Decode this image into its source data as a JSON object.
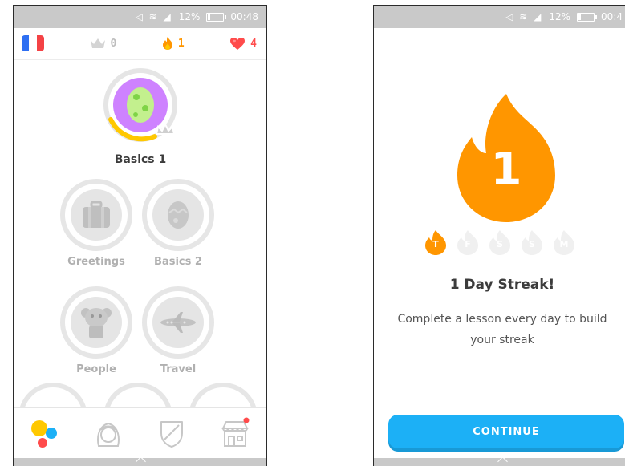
{
  "status_bar": {
    "battery": "12%",
    "time_left": "00:48",
    "time_right": "00:4"
  },
  "topbar": {
    "crowns": "0",
    "streak": "1",
    "hearts": "4"
  },
  "skills": {
    "main": {
      "label": "Basics 1"
    },
    "greetings": {
      "label": "Greetings"
    },
    "basics2": {
      "label": "Basics 2"
    },
    "people": {
      "label": "People"
    },
    "travel": {
      "label": "Travel"
    }
  },
  "tabs": [
    "learn",
    "profile",
    "leagues",
    "shop"
  ],
  "streak_screen": {
    "number": "1",
    "days": [
      "T",
      "F",
      "S",
      "S",
      "M"
    ],
    "title": "1 Day Streak!",
    "description": "Complete a lesson every day to build your streak",
    "continue_label": "CONTINUE"
  },
  "colors": {
    "accent_orange": "#ff9600",
    "accent_blue": "#1cb0f6",
    "heart_red": "#ff4b4b",
    "egg_purple": "#ce82ff"
  }
}
